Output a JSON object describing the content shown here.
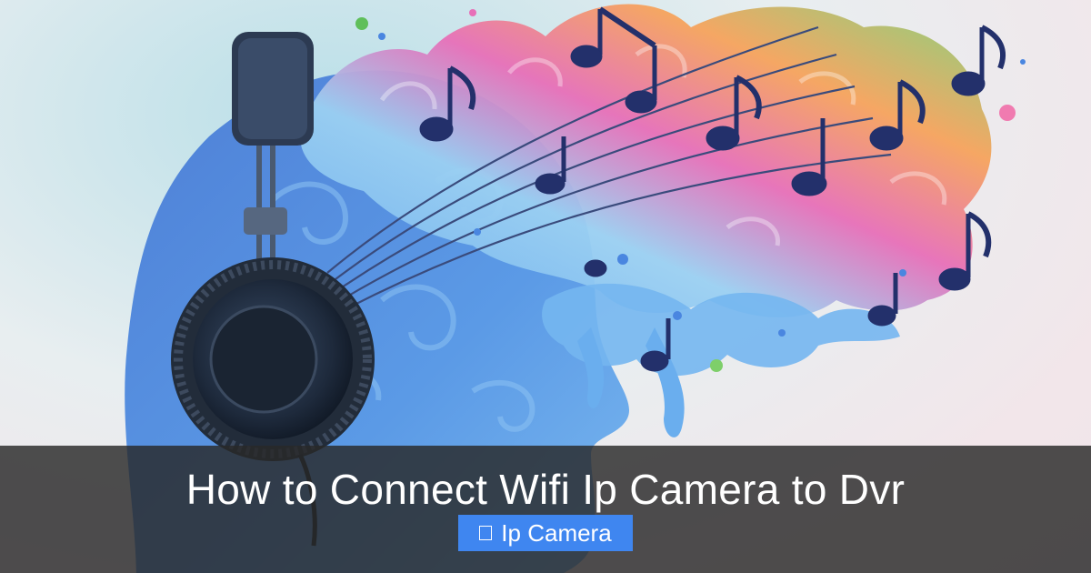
{
  "post": {
    "title": "How to Connect Wifi Ip Camera to Dvr",
    "category": {
      "icon": "folder-icon",
      "label": "Ip Camera"
    }
  },
  "hero_image": {
    "subject": "head-with-headphones-and-music-notes-illustration"
  },
  "colors": {
    "caption_band": "#282828",
    "badge": "#3f86f0",
    "title_text": "#ffffff"
  }
}
